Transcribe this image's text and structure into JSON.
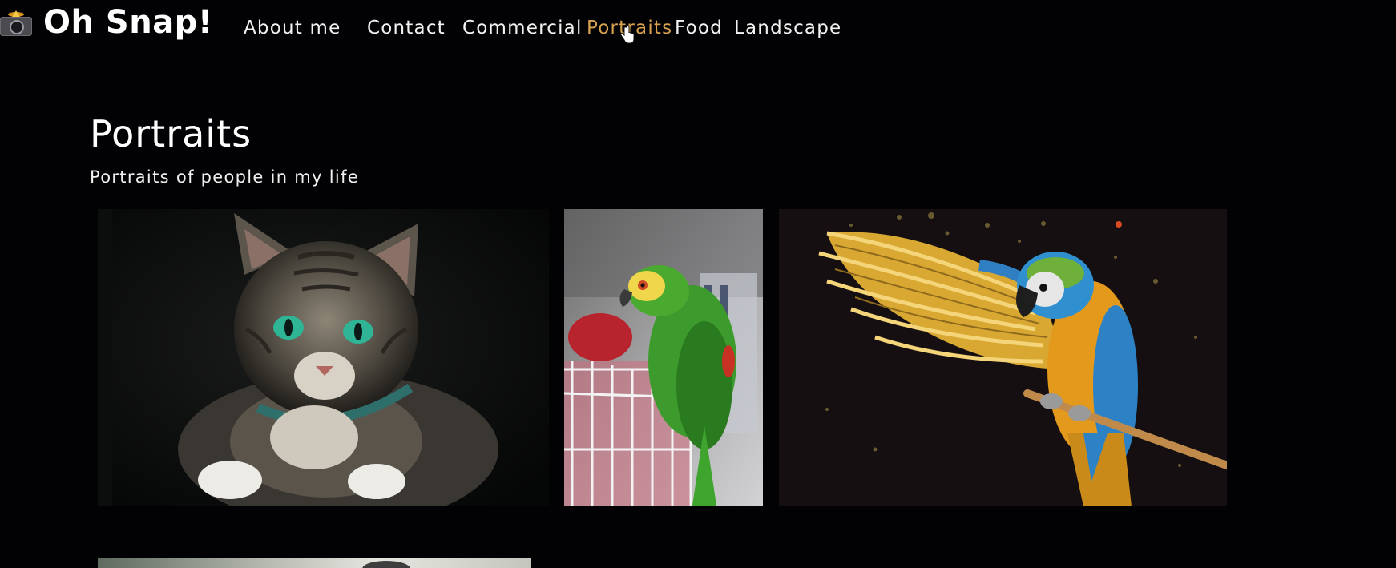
{
  "header": {
    "brand": "Oh Snap!",
    "logo_icon": "camera-flash-icon"
  },
  "nav": {
    "items": [
      {
        "label": "About me"
      },
      {
        "label": "Contact"
      },
      {
        "label": "Commercial"
      },
      {
        "label": "Portraits"
      },
      {
        "label": "Food"
      },
      {
        "label": "Landscape"
      }
    ],
    "active": "Portraits",
    "active_color": "#d6a24e"
  },
  "section": {
    "title": "Portraits",
    "subtitle": "Portraits of people in my life"
  },
  "gallery": {
    "images": [
      {
        "subject": "tabby cat with green eyes"
      },
      {
        "subject": "green parrot on white cage"
      },
      {
        "subject": "blue and gold macaw with spread wings"
      },
      {
        "subject": "partially visible photo"
      }
    ]
  },
  "colors": {
    "background": "#020204",
    "text": "#ffffff",
    "accent": "#d6a24e"
  }
}
